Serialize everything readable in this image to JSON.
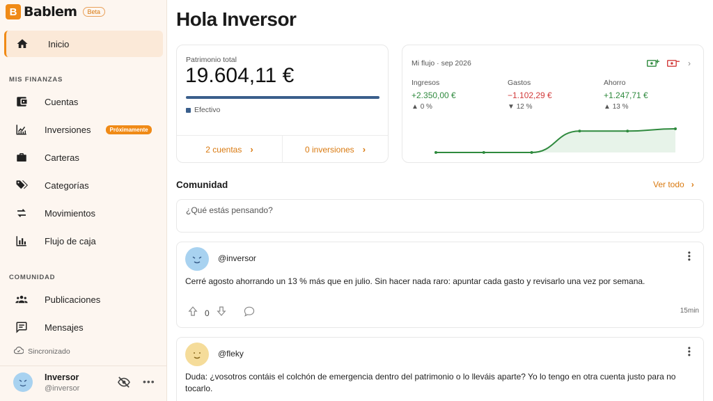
{
  "app": {
    "name": "Bablem",
    "badge": "Beta"
  },
  "sidebar": {
    "home": {
      "label": "Inicio",
      "icon": "home-icon"
    },
    "finance_section": "MIS FINANZAS",
    "finance_items": [
      {
        "label": "Cuentas",
        "icon": "wallet-icon"
      },
      {
        "label": "Inversiones",
        "icon": "investment-chart-icon",
        "badge": "Próximamente"
      },
      {
        "label": "Carteras",
        "icon": "briefcase-icon"
      },
      {
        "label": "Categorías",
        "icon": "tags-icon"
      },
      {
        "label": "Movimientos",
        "icon": "transfer-arrows-icon"
      },
      {
        "label": "Flujo de caja",
        "icon": "bar-chart-icon"
      }
    ],
    "community_section": "COMUNIDAD",
    "community_items": [
      {
        "label": "Publicaciones",
        "icon": "people-icon"
      },
      {
        "label": "Mensajes",
        "icon": "message-icon"
      }
    ],
    "sync_status": "Sincronizado",
    "user": {
      "name": "Inversor",
      "handle": "@inversor"
    }
  },
  "main": {
    "greeting": "Hola Inversor"
  },
  "patrimonio": {
    "label": "Patrimonio total",
    "value": "19.604,11 €",
    "legend": "Efectivo",
    "accounts_link": "2 cuentas",
    "investments_link": "0 inversiones",
    "bar_color": "#3a5f8c"
  },
  "flujo": {
    "title": "Mi flujo · sep 2026",
    "ingresos": {
      "label": "Ingresos",
      "value": "+2.350,00 €",
      "pct": "0 %",
      "trend": "up"
    },
    "gastos": {
      "label": "Gastos",
      "value": "−1.102,29 €",
      "pct": "12 %",
      "trend": "down"
    },
    "ahorro": {
      "label": "Ahorro",
      "value": "+1.247,71 €",
      "pct": "13 %",
      "trend": "up"
    },
    "sparkline": [
      0,
      0,
      0,
      0.95,
      0.95,
      1.05
    ],
    "accent_green": "#2f8a3e",
    "accent_red": "#d23a3a"
  },
  "community": {
    "title": "Comunidad",
    "see_all": "Ver todo",
    "composer_placeholder": "¿Qué estás pensando?",
    "posts": [
      {
        "handle": "@inversor",
        "body": "Cerré agosto ahorrando un 13 % más que en julio. Sin hacer nada raro: apuntar cada gasto y revisarlo una vez por semana.",
        "votes": "0",
        "time": "15min",
        "avatar_color": "#a8d2f0"
      },
      {
        "handle": "@fleky",
        "body": "Duda: ¿vosotros contáis el colchón de emergencia dentro del patrimonio o lo lleváis aparte? Yo lo tengo en otra cuenta justo para no tocarlo.",
        "avatar_color": "#f5dc9a"
      }
    ]
  },
  "colors": {
    "brand": "#f08a16",
    "sidebar_bg": "#fdf6f0"
  }
}
